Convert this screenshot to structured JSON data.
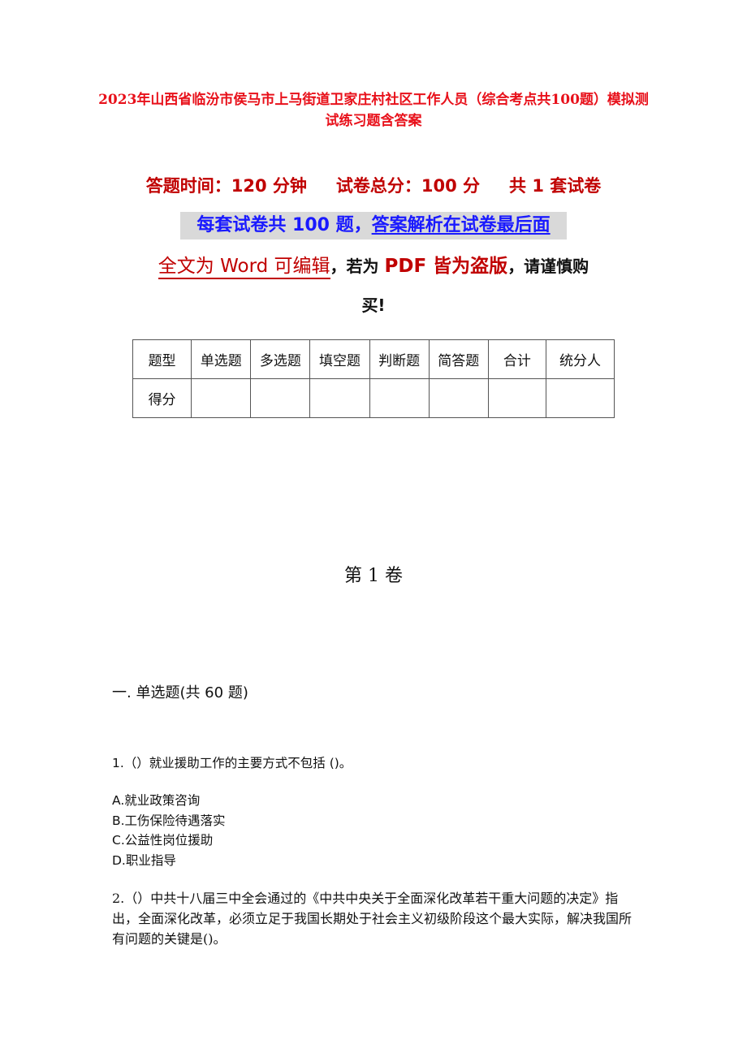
{
  "document": {
    "title": "2023年山西省临汾市侯马市上马街道卫家庄村社区工作人员（综合考点共100题）模拟测试练习题含答案",
    "info": {
      "time": "答题时间：120 分钟",
      "total_score": "试卷总分：100 分",
      "sets": "共 1 套试卷"
    },
    "notice_blue": {
      "part1": "每套试卷共 100 题，",
      "part2": "答案解析在试卷最后面"
    },
    "notice_word": {
      "part1": "全文为 Word 可编辑",
      "comma1": "，",
      "part2": "若为 ",
      "part3": "PDF 皆为盗版",
      "part4": "，请谨慎购",
      "part5": "买!"
    },
    "score_table": {
      "headers": [
        "题型",
        "单选题",
        "多选题",
        "填空题",
        "判断题",
        "简答题",
        "合计",
        "统分人"
      ],
      "row_label": "得分",
      "row_values": [
        "",
        "",
        "",
        "",
        "",
        "",
        ""
      ]
    },
    "volume_title": "第 1 卷",
    "section_title": "一. 单选题(共 60 题)",
    "questions": [
      {
        "text": "1.（）就业援助工作的主要方式不包括 ()。",
        "options": [
          "A.就业政策咨询",
          "B.工伤保险待遇落实",
          "C.公益性岗位援助",
          "D.职业指导"
        ]
      },
      {
        "text": "2.（）中共十八届三中全会通过的《中共中央关于全面深化改革若干重大问题的决定》指出，全面深化改革，必须立足于我国长期处于社会主义初级阶段这个最大实际，解决我国所有问题的关键是()。"
      }
    ]
  },
  "colors": {
    "title_red": "#e8101a",
    "dark_red": "#c00000",
    "blue": "#1a1aff",
    "highlight_gray": "#d9d9d9"
  }
}
